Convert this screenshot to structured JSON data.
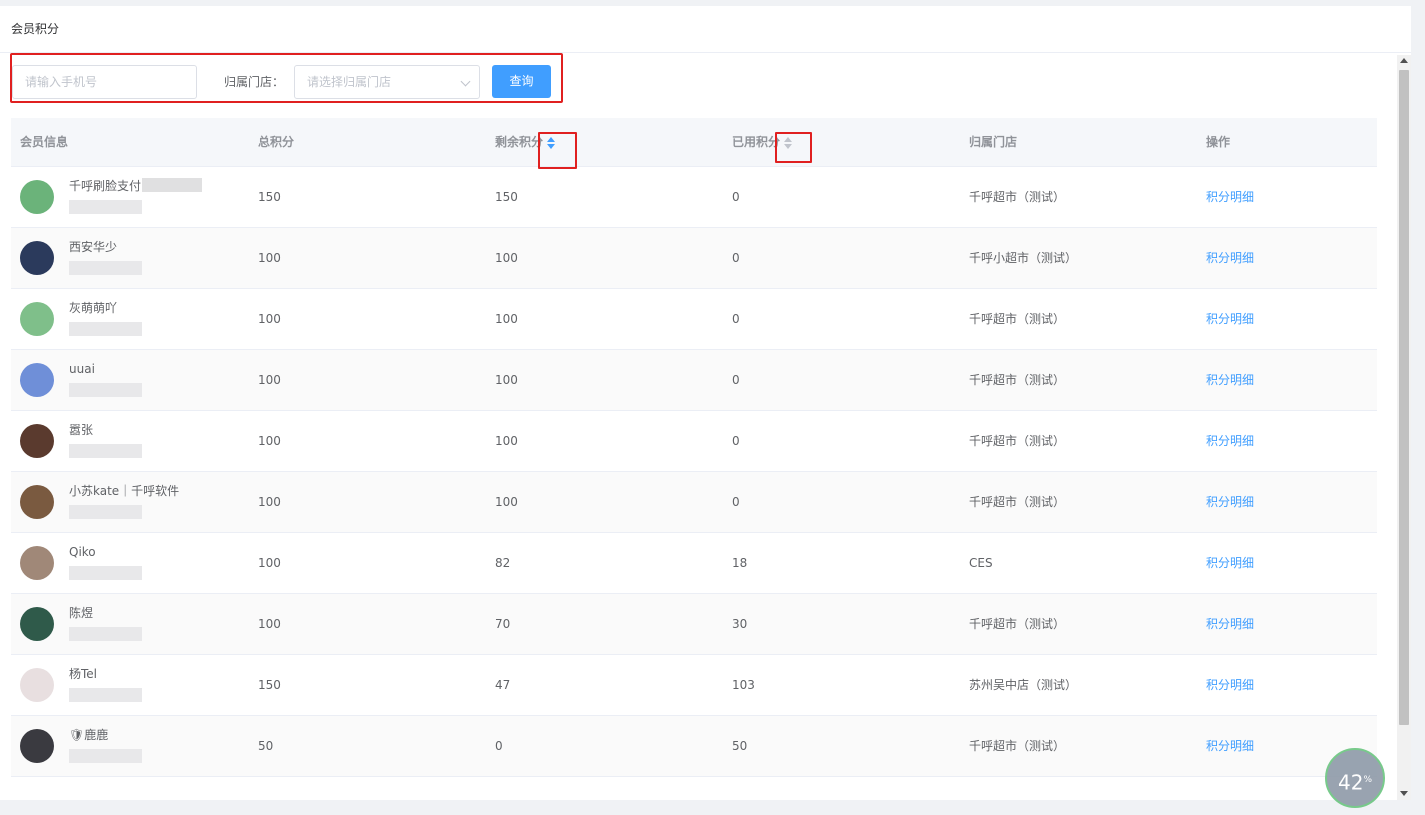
{
  "page": {
    "title": "会员积分"
  },
  "filter": {
    "phone_placeholder": "请输入手机号",
    "store_label": "归属门店：",
    "store_placeholder": "请选择归属门店",
    "query_label": "查询"
  },
  "table": {
    "headers": {
      "member": "会员信息",
      "total": "总积分",
      "remaining": "剩余积分",
      "used": "已用积分",
      "store": "归属门店",
      "action": "操作"
    },
    "rows": [
      {
        "name": "千呼刷脸支付",
        "total": "150",
        "remaining": "150",
        "used": "0",
        "store": "千呼超市（测试）",
        "action": "积分明细",
        "avatar_color": "#6bb37a"
      },
      {
        "name": "西安华少",
        "total": "100",
        "remaining": "100",
        "used": "0",
        "store": "千呼小超市（测试）",
        "action": "积分明细",
        "avatar_color": "#2b3a5c"
      },
      {
        "name": "灰萌萌吖",
        "total": "100",
        "remaining": "100",
        "used": "0",
        "store": "千呼超市（测试）",
        "action": "积分明细",
        "avatar_color": "#7fbf8a"
      },
      {
        "name": "uuai",
        "total": "100",
        "remaining": "100",
        "used": "0",
        "store": "千呼超市（测试）",
        "action": "积分明细",
        "avatar_color": "#6f8fd8"
      },
      {
        "name": "嚣张",
        "total": "100",
        "remaining": "100",
        "used": "0",
        "store": "千呼超市（测试）",
        "action": "积分明细",
        "avatar_color": "#5a3a2e"
      },
      {
        "name": "小苏kate｜千呼软件",
        "total": "100",
        "remaining": "100",
        "used": "0",
        "store": "千呼超市（测试）",
        "action": "积分明细",
        "avatar_color": "#7a5a40"
      },
      {
        "name": "Qiko",
        "total": "100",
        "remaining": "82",
        "used": "18",
        "store": "CES",
        "action": "积分明细",
        "avatar_color": "#a08878"
      },
      {
        "name": "陈煜",
        "total": "100",
        "remaining": "70",
        "used": "30",
        "store": "千呼超市（测试）",
        "action": "积分明细",
        "avatar_color": "#2f5a4a"
      },
      {
        "name": "杨Tel",
        "total": "150",
        "remaining": "47",
        "used": "103",
        "store": "苏州吴中店（测试）",
        "action": "积分明细",
        "avatar_color": "#e8dfe0"
      },
      {
        "name": "🛡鹿鹿",
        "total": "50",
        "remaining": "0",
        "used": "50",
        "store": "千呼超市（测试）",
        "action": "积分明细",
        "avatar_color": "#3a3a40"
      }
    ]
  },
  "overlay": {
    "speed_value": "42",
    "speed_unit": "%"
  },
  "colors": {
    "accent": "#409eff",
    "highlight": "#e02020"
  }
}
